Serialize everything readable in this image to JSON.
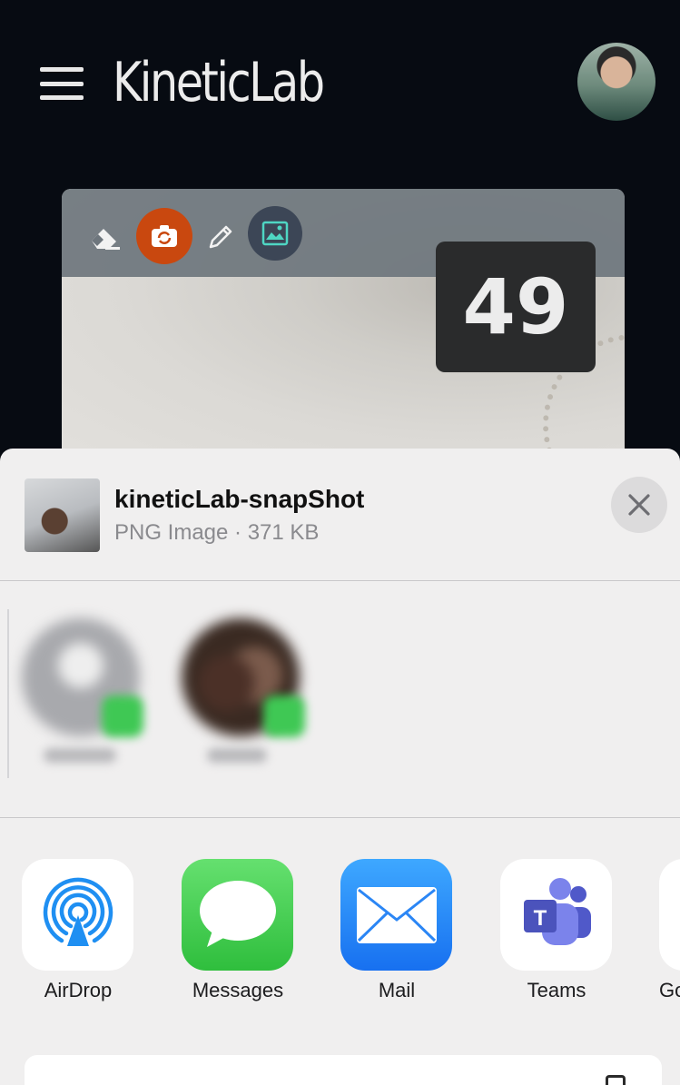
{
  "header": {
    "title": "KineticLab",
    "menu_icon": "hamburger-menu-icon",
    "avatar_icon": "user-avatar"
  },
  "capture": {
    "counter": "49",
    "tools": [
      "eraser-icon",
      "camera-switch-icon",
      "pencil-icon",
      "gallery-icon"
    ],
    "colors": {
      "camera_button": "#c9480f",
      "gallery_button": "#3c4656"
    }
  },
  "share_sheet": {
    "file_name": "kineticLab-snapShot",
    "file_meta": "PNG Image · 371 KB",
    "close_icon": "close-icon",
    "apps": [
      {
        "label": "AirDrop",
        "icon": "airdrop-icon"
      },
      {
        "label": "Messages",
        "icon": "messages-icon"
      },
      {
        "label": "Mail",
        "icon": "mail-icon"
      },
      {
        "label": "Teams",
        "icon": "teams-icon"
      },
      {
        "label": "Go",
        "icon": "google-icon"
      }
    ]
  }
}
